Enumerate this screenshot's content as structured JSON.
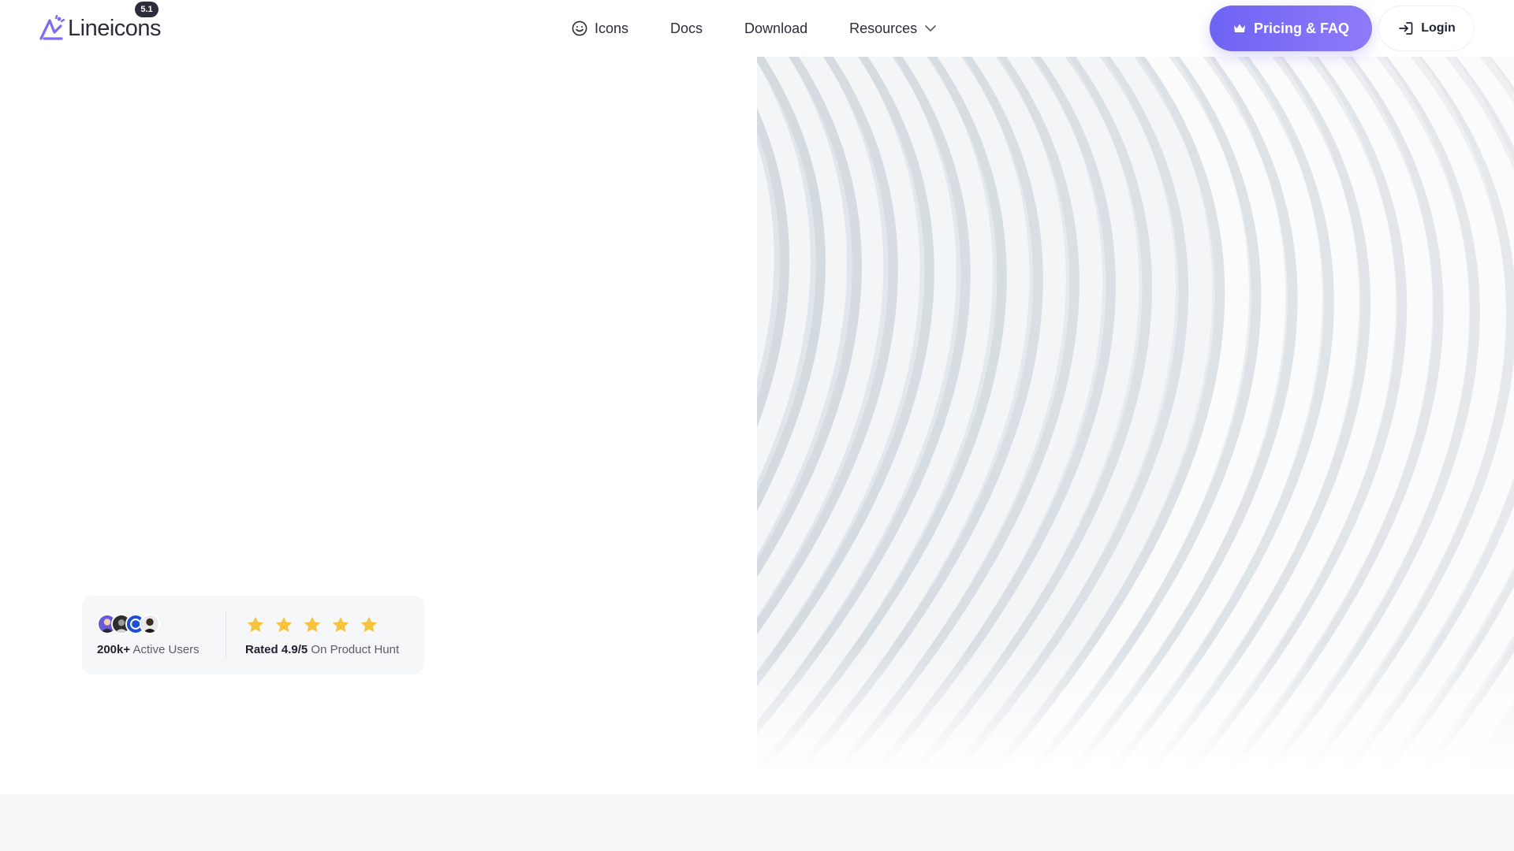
{
  "brand": {
    "name": "Lineicons",
    "version": "5.1",
    "accent": "#7a6cf6"
  },
  "nav": {
    "items": [
      {
        "label": "Icons",
        "icon": "smiley-icon"
      },
      {
        "label": "Docs"
      },
      {
        "label": "Download"
      },
      {
        "label": "Resources",
        "icon": "chevron-down-icon"
      }
    ]
  },
  "header_actions": {
    "pricing_label": "Pricing & FAQ",
    "pricing_icon": "crown-icon",
    "login_label": "Login",
    "login_icon": "login-icon"
  },
  "social_proof": {
    "users_count": "200k+",
    "users_label": "Active Users",
    "avatars": 4,
    "rating_prefix": "Rated",
    "rating_value": "4.9/5",
    "rating_suffix": "On Product Hunt",
    "stars": 5,
    "star_color": "#f7c23c"
  },
  "hero": {
    "image": "white curved architectural ribs"
  }
}
